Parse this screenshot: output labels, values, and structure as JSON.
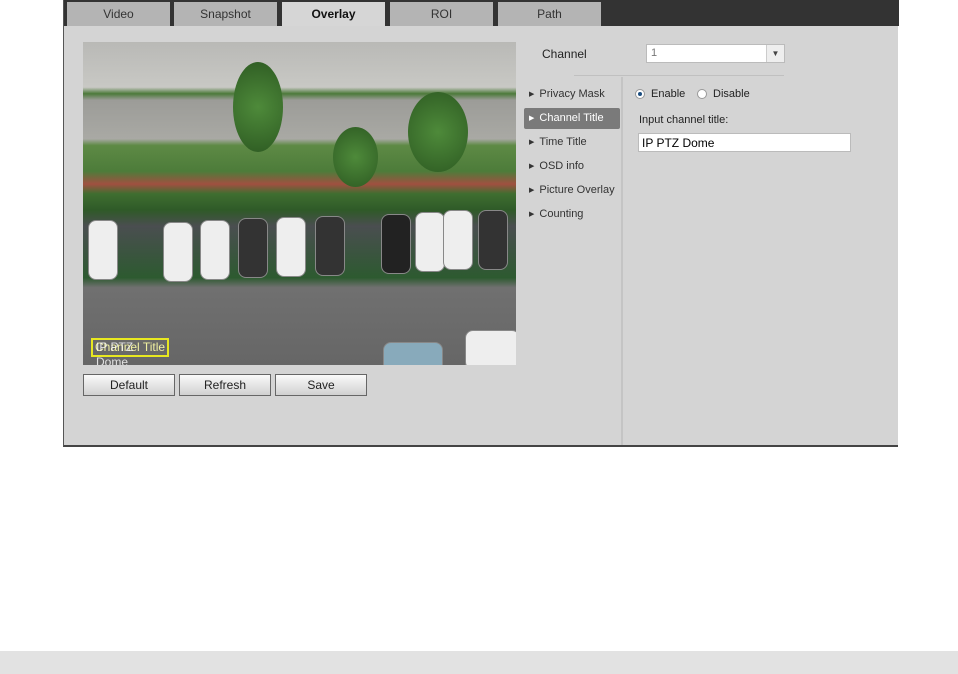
{
  "tabs": [
    {
      "label": "Video"
    },
    {
      "label": "Snapshot"
    },
    {
      "label": "Overlay",
      "active": true
    },
    {
      "label": "ROI"
    },
    {
      "label": "Path"
    }
  ],
  "video": {
    "osd_title": "IP PTZ Dome",
    "osd_overlap": "Channel Title",
    "osd_box_color": "#e8e820"
  },
  "buttons": {
    "default": "Default",
    "refresh": "Refresh",
    "save": "Save"
  },
  "channel": {
    "label": "Channel",
    "value": "1"
  },
  "menu": [
    {
      "label": "Privacy Mask"
    },
    {
      "label": "Channel Title",
      "active": true
    },
    {
      "label": "Time Title"
    },
    {
      "label": "OSD info"
    },
    {
      "label": "Picture Overlay"
    },
    {
      "label": "Counting"
    }
  ],
  "settings": {
    "enable": "Enable",
    "disable": "Disable",
    "selected": "Enable",
    "input_label": "Input channel title:",
    "input_value": "IP PTZ Dome"
  }
}
